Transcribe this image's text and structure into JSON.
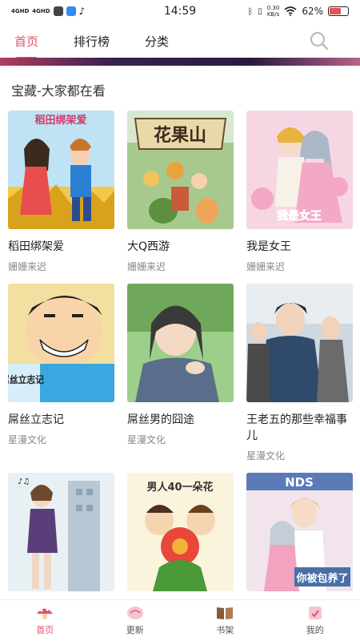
{
  "status_bar": {
    "signal1": "4GHD",
    "signal2": "4GHD",
    "time": "14:59",
    "net_speed_value": "0.30",
    "net_speed_unit": "KB/s",
    "battery": "62%",
    "icons": [
      "chat-icon",
      "app-icon",
      "tiktok-icon",
      "bluetooth-icon",
      "vibrate-icon",
      "wifi-icon",
      "battery-icon"
    ]
  },
  "nav": {
    "tabs": [
      {
        "label": "首页",
        "active": true
      },
      {
        "label": "排行榜",
        "active": false
      },
      {
        "label": "分类",
        "active": false
      }
    ],
    "search_icon": "search-icon",
    "accent": "#e0546a"
  },
  "section": {
    "title": "宝藏-大家都在看"
  },
  "comics": [
    {
      "title": "稻田绑架爱",
      "author": "姗姗来迟",
      "cover_text": "稻田绑架爱"
    },
    {
      "title": "大Q西游",
      "author": "姗姗来迟",
      "cover_text": "花果山"
    },
    {
      "title": "我是女王",
      "author": "姗姗来迟",
      "cover_text": "我是女王"
    },
    {
      "title": "屌丝立志记",
      "author": "星漫文化",
      "cover_text": "屌丝立志记"
    },
    {
      "title": "屌丝男的囧途",
      "author": "星漫文化",
      "cover_text": ""
    },
    {
      "title": "王老五的那些幸福事儿",
      "author": "星漫文化",
      "cover_text": ""
    },
    {
      "title": "",
      "author": "",
      "cover_text": ""
    },
    {
      "title": "",
      "author": "",
      "cover_text": "男人40一朵花"
    },
    {
      "title": "",
      "author": "",
      "cover_text": "你被包养了"
    }
  ],
  "bottom_nav": [
    {
      "label": "首页",
      "icon": "mushroom-icon",
      "active": true
    },
    {
      "label": "更新",
      "icon": "update-icon",
      "active": false
    },
    {
      "label": "书架",
      "icon": "bookshelf-icon",
      "active": false
    },
    {
      "label": "我的",
      "icon": "profile-icon",
      "active": false
    }
  ]
}
